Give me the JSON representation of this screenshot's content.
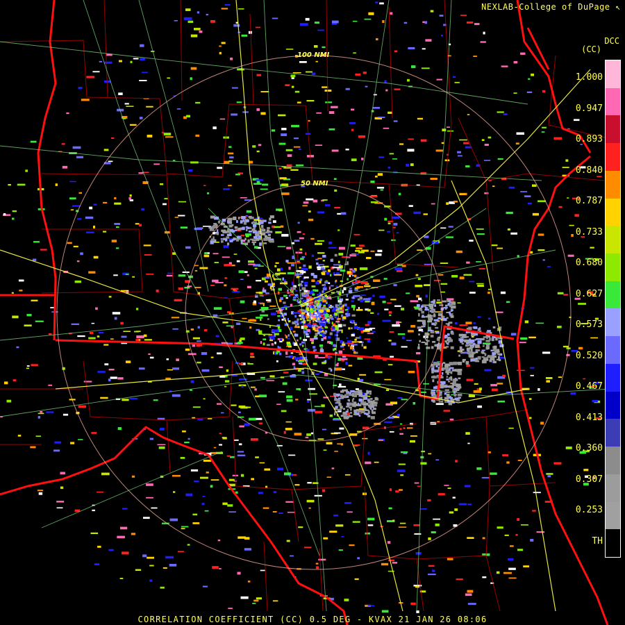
{
  "credit": "NEXLAB-College of DuPage",
  "product": {
    "code": "DCC",
    "unit": "(CC)"
  },
  "footer": "CORRELATION COEFFICIENT (CC) 0.5 DEG - KVAX 21 JAN 26 08:06",
  "range_rings": {
    "outer_label": "100 NMI",
    "inner_label": "50 NMI"
  },
  "legend": {
    "ticks": [
      "1.000",
      "0.947",
      "0.893",
      "0.840",
      "0.787",
      "0.733",
      "0.680",
      "0.627",
      "0.573",
      "0.520",
      "0.467",
      "0.413",
      "0.360",
      "0.307",
      "0.253",
      "TH"
    ],
    "colors": [
      "#ffb6d9",
      "#ff69b4",
      "#c8102e",
      "#ff2020",
      "#ff8c00",
      "#ffd200",
      "#c8e600",
      "#8ee800",
      "#39e839",
      "#9aa0ff",
      "#6a6aff",
      "#1e1eff",
      "#0000c8",
      "#3c3cb4",
      "#8c8c8c",
      "#9c9c9c",
      "#a0a0a0",
      "#000000"
    ]
  },
  "colors": {
    "state_border": "#ff0000",
    "county_border": "#c00000",
    "highway": "#ffff55",
    "road": "#7fd87f",
    "ring": "#ffb0a0",
    "text": "#ffff55"
  }
}
